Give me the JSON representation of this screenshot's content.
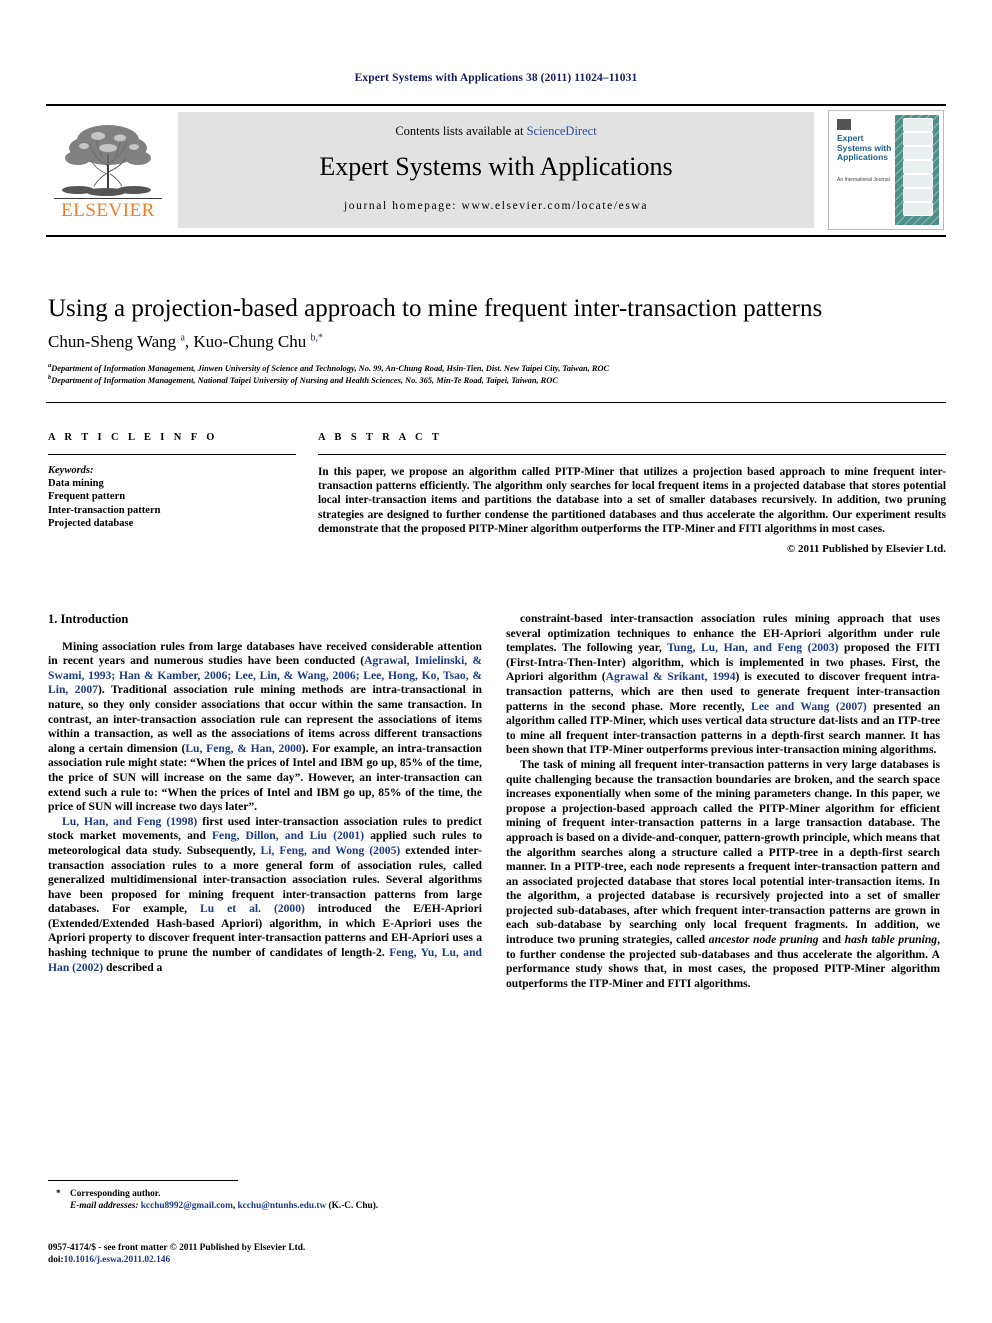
{
  "running_head": "Expert Systems with Applications 38 (2011) 11024–11031",
  "masthead": {
    "contents_text": "Contents lists available at ",
    "sciencedirect": "ScienceDirect",
    "journal_title": "Expert Systems with Applications",
    "homepage": "journal homepage: www.elsevier.com/locate/eswa",
    "publisher": "ELSEVIER",
    "cover": {
      "title": "Expert Systems with Applications",
      "subtitle": "An International Journal"
    },
    "colors": {
      "link": "#2b4ea2",
      "elsevier_orange": "#f07c22",
      "cover_teal": "#4e8f88",
      "banner_gray": "#e2e2e2"
    }
  },
  "article": {
    "title": "Using a projection-based approach to mine frequent inter-transaction patterns",
    "authors_html": "Chun-Sheng Wang <sup>a</sup>, Kuo-Chung Chu <sup>b,*</sup>",
    "affiliation_a": "Department of Information Management, Jinwen University of Science and Technology, No. 99, An-Chung Road, Hsin-Tien, Dist. New Taipei City, Taiwan, ROC",
    "affiliation_b": "Department of Information Management, National Taipei University of Nursing and Health Sciences, No. 365, Min-Te Road, Taipei, Taiwan, ROC"
  },
  "article_info": {
    "heading": "A R T I C L E   I N F O",
    "keywords_label": "Keywords:",
    "keywords": [
      "Data mining",
      "Frequent pattern",
      "Inter-transaction pattern",
      "Projected database"
    ]
  },
  "abstract": {
    "heading": "A B S T R A C T",
    "text": "In this paper, we propose an algorithm called PITP-Miner that utilizes a projection based approach to mine frequent inter-transaction patterns efficiently. The algorithm only searches for local frequent items in a projected database that stores potential local inter-transaction items and partitions the database into a set of smaller databases recursively. In addition, two pruning strategies are designed to further condense the partitioned databases and thus accelerate the algorithm. Our experiment results demonstrate that the proposed PITP-Miner algorithm outperforms the ITP-Miner and FITI algorithms in most cases.",
    "copyright": "© 2011 Published by Elsevier Ltd."
  },
  "body": {
    "section_heading": "1. Introduction",
    "left_paragraphs": [
      [
        {
          "t": "Mining association rules from large databases have received considerable attention in recent years and numerous studies have been conducted ("
        },
        {
          "t": "Agrawal, Imielinski, & Swami, 1993; Han & Kamber, 2006; Lee, Lin, & Wang, 2006; Lee, Hong, Ko, Tsao, & Lin, 2007",
          "c": true
        },
        {
          "t": "). Traditional association rule mining methods are intra-transactional in nature, so they only consider associations that occur within the same transaction. In contrast, an inter-transaction association rule can represent the associations of items within a transaction, as well as the associations of items across different transactions along a certain dimension ("
        },
        {
          "t": "Lu, Feng, & Han, 2000",
          "c": true
        },
        {
          "t": "). For example, an intra-transaction association rule might state: “When the prices of Intel and IBM go up, 85% of the time, the price of SUN will increase on the same day”. However, an inter-transaction can extend such a rule to: “When the prices of Intel and IBM go up, 85% of the time, the price of SUN will increase two days later”."
        }
      ],
      [
        {
          "t": "Lu, Han, and Feng (1998)",
          "c": true
        },
        {
          "t": " first used inter-transaction association rules to predict stock market movements, and "
        },
        {
          "t": "Feng, Dillon, and Liu (2001)",
          "c": true
        },
        {
          "t": " applied such rules to meteorological data study. Subsequently, "
        },
        {
          "t": "Li, Feng, and Wong (2005)",
          "c": true
        },
        {
          "t": " extended inter-transaction association rules to a more general form of association rules, called generalized multidimensional inter-transaction association rules. Several algorithms have been proposed for mining frequent inter-transaction patterns from large databases. For example, "
        },
        {
          "t": "Lu et al. (2000)",
          "c": true
        },
        {
          "t": " introduced the E/EH-Apriori (Extended/Extended Hash-based Apriori) algorithm, in which E-Apriori uses the Apriori property to discover frequent inter-transaction patterns and EH-Apriori uses a hashing technique to prune the number of candidates of length-2. "
        },
        {
          "t": "Feng, Yu, Lu, and Han (2002)",
          "c": true
        },
        {
          "t": " described a"
        }
      ]
    ],
    "right_paragraphs": [
      [
        {
          "t": "constraint-based inter-transaction association rules mining approach that uses several optimization techniques to enhance the EH-Apriori algorithm under rule templates. The following year, "
        },
        {
          "t": "Tung, Lu, Han, and Feng (2003)",
          "c": true
        },
        {
          "t": " proposed the FITI (First-Intra-Then-Inter) algorithm, which is implemented in two phases. First, the Apriori algorithm ("
        },
        {
          "t": "Agrawal & Srikant, 1994",
          "c": true
        },
        {
          "t": ") is executed to discover frequent intra-transaction patterns, which are then used to generate frequent inter-transaction patterns in the second phase. More recently, "
        },
        {
          "t": "Lee and Wang (2007)",
          "c": true
        },
        {
          "t": " presented an algorithm called ITP-Miner, which uses vertical data structure dat-lists and an ITP-tree to mine all frequent inter-transaction patterns in a depth-first search manner. It has been shown that ITP-Miner outperforms previous inter-transaction mining algorithms."
        }
      ],
      [
        {
          "t": "The task of mining all frequent inter-transaction patterns in very large databases is quite challenging because the transaction boundaries are broken, and the search space increases exponentially when some of the mining parameters change. In this paper, we propose a projection-based approach called the PITP-Miner algorithm for efficient mining of frequent inter-transaction patterns in a large transaction database. The approach is based on a divide-and-conquer, pattern-growth principle, which means that the algorithm searches along a structure called a PITP-tree in a depth-first search manner. In a PITP-tree, each node represents a frequent inter-transaction pattern and an associated projected database that stores local potential inter-transaction items. In the algorithm, a projected database is recursively projected into a set of smaller projected sub-databases, after which frequent inter-transaction patterns are grown in each sub-database by searching only local frequent fragments. In addition, we introduce two pruning strategies, called "
        },
        {
          "t": "ancestor node pruning",
          "i": true
        },
        {
          "t": " and "
        },
        {
          "t": "hash table pruning",
          "i": true
        },
        {
          "t": ", to further condense the projected sub-databases and thus accelerate the algorithm. A performance study shows that, in most cases, the proposed PITP-Miner algorithm outperforms the ITP-Miner and FITI algorithms."
        }
      ]
    ]
  },
  "footnotes": {
    "star": "*",
    "corresponding": "Corresponding author.",
    "email_label": "E-mail addresses:",
    "email1": "kcchu8992@gmail.com",
    "email2": "kcchu@ntunhs.edu.tw",
    "email_suffix": "(K.-C. Chu)."
  },
  "imprint": {
    "issn_line": "0957-4174/$ - see front matter © 2011 Published by Elsevier Ltd.",
    "doi_label": "doi:",
    "doi_value": "10.1016/j.eswa.2011.02.146"
  }
}
